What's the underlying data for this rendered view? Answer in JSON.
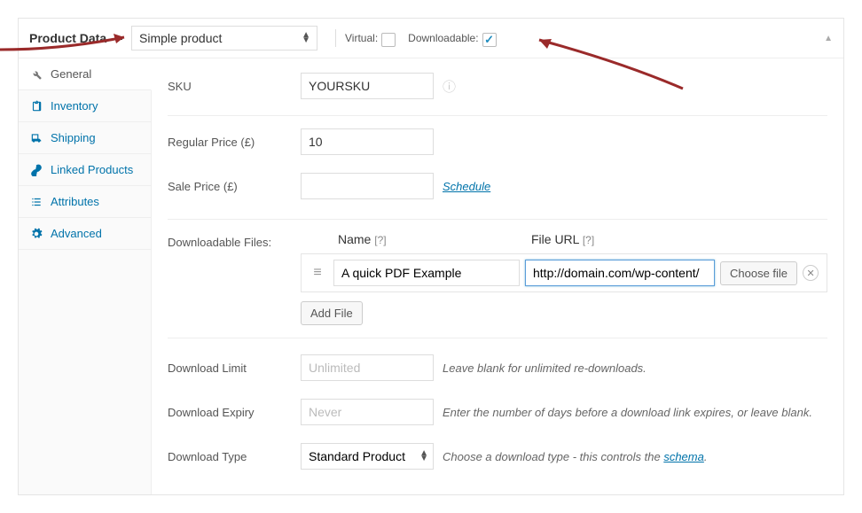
{
  "header": {
    "title": "Product Data",
    "product_type": "Simple product",
    "virtual_label": "Virtual:",
    "downloadable_label": "Downloadable:"
  },
  "tabs": {
    "general": "General",
    "inventory": "Inventory",
    "shipping": "Shipping",
    "linked": "Linked Products",
    "attributes": "Attributes",
    "advanced": "Advanced"
  },
  "fields": {
    "sku_label": "SKU",
    "sku_value": "YOURSKU",
    "regular_price_label": "Regular Price (£)",
    "regular_price_value": "10",
    "sale_price_label": "Sale Price (£)",
    "sale_price_value": "",
    "schedule": "Schedule",
    "dl_files_label": "Downloadable Files:",
    "dl_name_header": "Name",
    "dl_url_header": "File URL",
    "qmark": "[?]",
    "file_name": "A quick PDF Example",
    "file_url": "http://domain.com/wp-content/",
    "choose_file": "Choose file",
    "add_file": "Add File",
    "dl_limit_label": "Download Limit",
    "dl_limit_placeholder": "Unlimited",
    "dl_limit_desc": "Leave blank for unlimited re-downloads.",
    "dl_expiry_label": "Download Expiry",
    "dl_expiry_placeholder": "Never",
    "dl_expiry_desc": "Enter the number of days before a download link expires, or leave blank.",
    "dl_type_label": "Download Type",
    "dl_type_value": "Standard Product",
    "dl_type_desc_pre": "Choose a download type - this controls the ",
    "dl_type_schema": "schema",
    "dl_type_desc_post": "."
  }
}
